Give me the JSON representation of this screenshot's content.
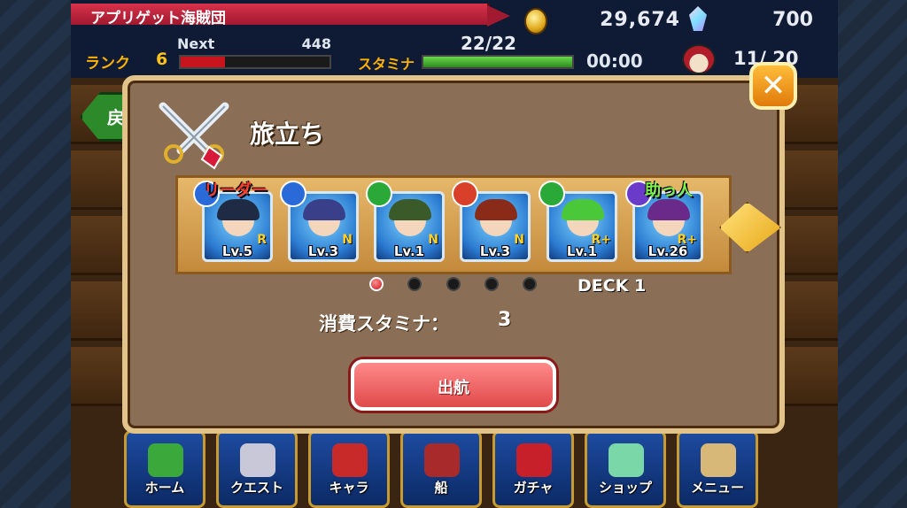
{
  "header": {
    "crew_name": "アプリゲット海賊団",
    "gold": "29,674",
    "gems": "700",
    "rank_label": "ランク",
    "rank": "6",
    "next_label": "Next",
    "next_value": "448",
    "exp_progress": 0.3,
    "stamina_label": "スタミナ",
    "stamina": "22/22",
    "stamina_progress": 1.0,
    "timer": "00:00",
    "crew_count": "11/ 20"
  },
  "background": {
    "back_button_label": "戻"
  },
  "dialog": {
    "title": "旅立ち",
    "leader_tag": "リーダー",
    "helper_tag": "助っ人",
    "deck_label": "DECK 1",
    "stamina_cost_label": "消費スタミナ：",
    "stamina_cost_value": "3",
    "depart_label": "出航",
    "close_label": "✕",
    "page_count": 5,
    "active_page": 1,
    "cards": [
      {
        "level": "Lv.5",
        "rarity": "R",
        "hair": "#1f2a44",
        "element": "#2a6ad8"
      },
      {
        "level": "Lv.3",
        "rarity": "N",
        "hair": "#3a3f8a",
        "element": "#2a6ad8"
      },
      {
        "level": "Lv.1",
        "rarity": "N",
        "hair": "#3a5a2a",
        "element": "#2aa838"
      },
      {
        "level": "Lv.3",
        "rarity": "N",
        "hair": "#8a2a18",
        "element": "#d8402a"
      },
      {
        "level": "Lv.1",
        "rarity": "R+",
        "hair": "#4ac83a",
        "element": "#2aa838"
      },
      {
        "level": "Lv.26",
        "rarity": "R+",
        "hair": "#6a2a8a",
        "element": "#6a3ac8"
      }
    ]
  },
  "nav": [
    {
      "label": "ホーム",
      "icon": "palm-tree-icon",
      "color": "#3aa83a"
    },
    {
      "label": "クエスト",
      "icon": "crossed-swords-icon",
      "color": "#c8c8d8"
    },
    {
      "label": "キャラ",
      "icon": "pirate-face-icon",
      "color": "#c82a2a"
    },
    {
      "label": "船",
      "icon": "ship-icon",
      "color": "#a82a2a"
    },
    {
      "label": "ガチャ",
      "icon": "treasure-chest-icon",
      "color": "#c8202a"
    },
    {
      "label": "ショップ",
      "icon": "crystal-icon",
      "color": "#7ad8a8"
    },
    {
      "label": "メニュー",
      "icon": "scroll-icon",
      "color": "#d8b878"
    }
  ]
}
